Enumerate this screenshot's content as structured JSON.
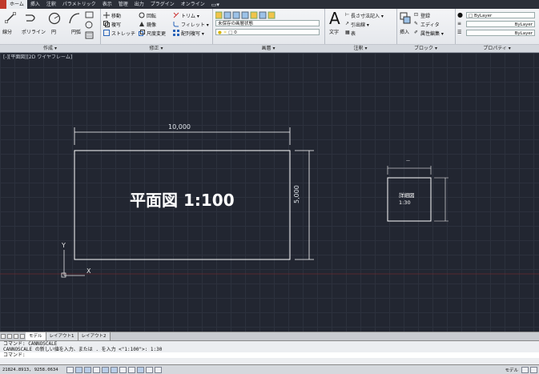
{
  "ribbon": {
    "tabs": [
      "ホーム",
      "挿入",
      "注釈",
      "パラメトリック",
      "表示",
      "管理",
      "出力",
      "プラグイン",
      "オンライン",
      "▭▾"
    ],
    "active_tab": 0,
    "draw_panel": {
      "title": "作成 ▾",
      "line": "線分",
      "polyline": "ポリライン",
      "circle": "円",
      "arc": "円弧"
    },
    "modify_panel": {
      "title": "修正 ▾",
      "items": [
        "移動",
        "回転",
        "トリム ▾",
        "複写",
        "鏡像",
        "フィレット ▾",
        "ストレッチ",
        "尺度変更",
        "配列複写 ▾"
      ]
    },
    "layers_panel": {
      "title": "画層 ▾",
      "layer_combo": "未保存の画層状態",
      "layer_name": "0"
    },
    "annotation_panel": {
      "title": "注釈 ▾",
      "text": "文字",
      "dimension": "長さ寸法記入 ▾",
      "leader": "引出線 ▾",
      "table": "表"
    },
    "block_panel": {
      "title": "ブロック ▾",
      "insert": "挿入",
      "create": "登録",
      "edit": "エディタ",
      "edit_attr": "属性編集 ▾"
    },
    "properties_panel": {
      "title": "プロパティ ▾",
      "color": "ByLayer",
      "linetype": "ByLayer",
      "lineweight": "ByLayer"
    }
  },
  "viewport": {
    "label": "[-][平面図][2D ワイヤフレーム]",
    "dimension_horizontal": "10,000",
    "dimension_vertical": "5,000",
    "main_text": "平面図 1:100",
    "small_box_text_line1": "詳細図",
    "small_box_text_line2": "1:30",
    "small_dim": "—",
    "ucs_y": "Y",
    "ucs_x": "X"
  },
  "layout_tabs": [
    "モデル",
    "レイアウト1",
    "レイアウト2"
  ],
  "active_layout_tab": 0,
  "command": {
    "history": [
      "コマンド: CANNOSCALE",
      "CANNOSCALE の新しい値を入力、または . を入力 <\"1:100\">: 1:30"
    ],
    "prompt": "コマンド:"
  },
  "status": {
    "coordinates": "21824.8913, 9258.0634",
    "model_label": "モデル"
  },
  "colors": {
    "background": "#222631",
    "drawing_lines": "#ffffff",
    "ribbon_bg": "#e8ebef",
    "tab_bar": "#2b2f38"
  }
}
